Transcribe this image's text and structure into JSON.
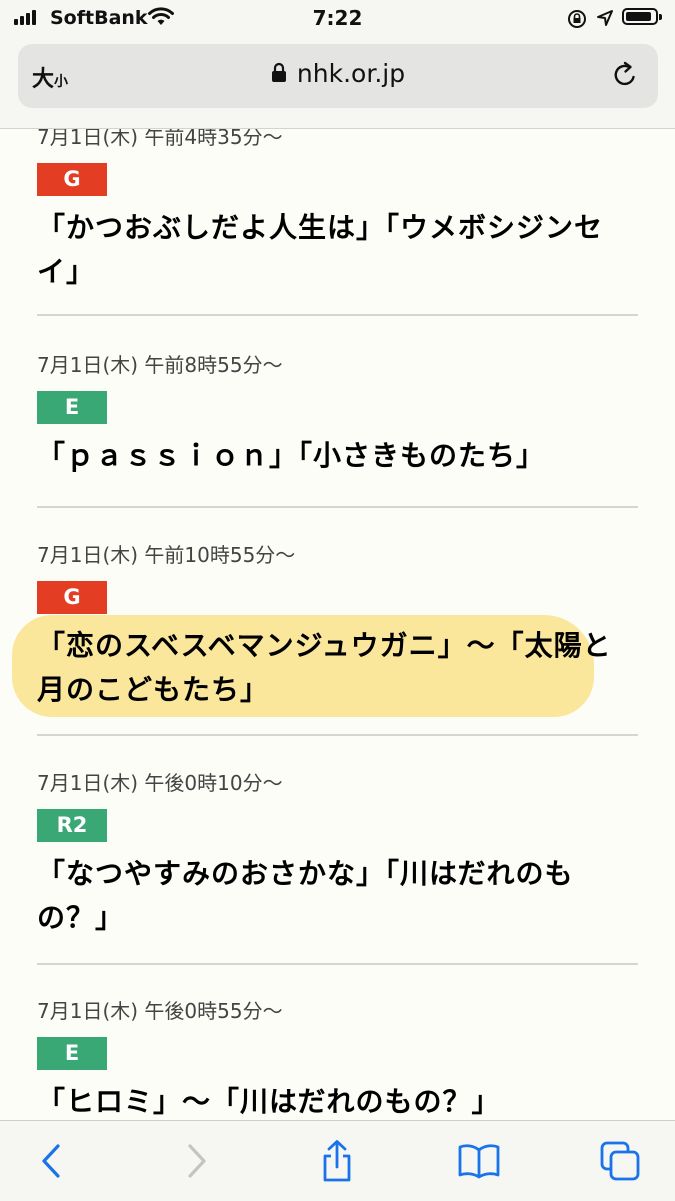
{
  "status_bar": {
    "carrier": "SoftBank",
    "time": "7:22",
    "battery_level": 0.88
  },
  "url_bar": {
    "text_size_large": "大",
    "text_size_small": "小",
    "domain": "nhk.or.jp"
  },
  "colors": {
    "G": "#e33d23",
    "E": "#3aa874",
    "R2": "#3aa874",
    "highlight": "#f7d650"
  },
  "schedule": [
    {
      "date": "7月1日(木) 午前4時35分〜",
      "channel": "G",
      "title": "「かつおぶしだよ人生は」「ウメボシジンセイ」"
    },
    {
      "date": "7月1日(木) 午前8時55分〜",
      "channel": "E",
      "title": "「ｐａｓｓｉｏｎ」「小さきものたち」"
    },
    {
      "date": "7月1日(木) 午前10時55分〜",
      "channel": "G",
      "title": "「恋のスベスベマンジュウガニ」〜「太陽と月のこどもたち」"
    },
    {
      "date": "7月1日(木) 午後0時10分〜",
      "channel": "R2",
      "title": "「なつやすみのおさかな」「川はだれのもの？」"
    },
    {
      "date": "7月1日(木) 午後0時55分〜",
      "channel": "E",
      "title": "「ヒロミ」〜「川はだれのもの？」"
    }
  ],
  "toolbar": {
    "icons": [
      "back-icon",
      "forward-icon",
      "share-icon",
      "bookmarks-icon",
      "tabs-icon"
    ]
  }
}
